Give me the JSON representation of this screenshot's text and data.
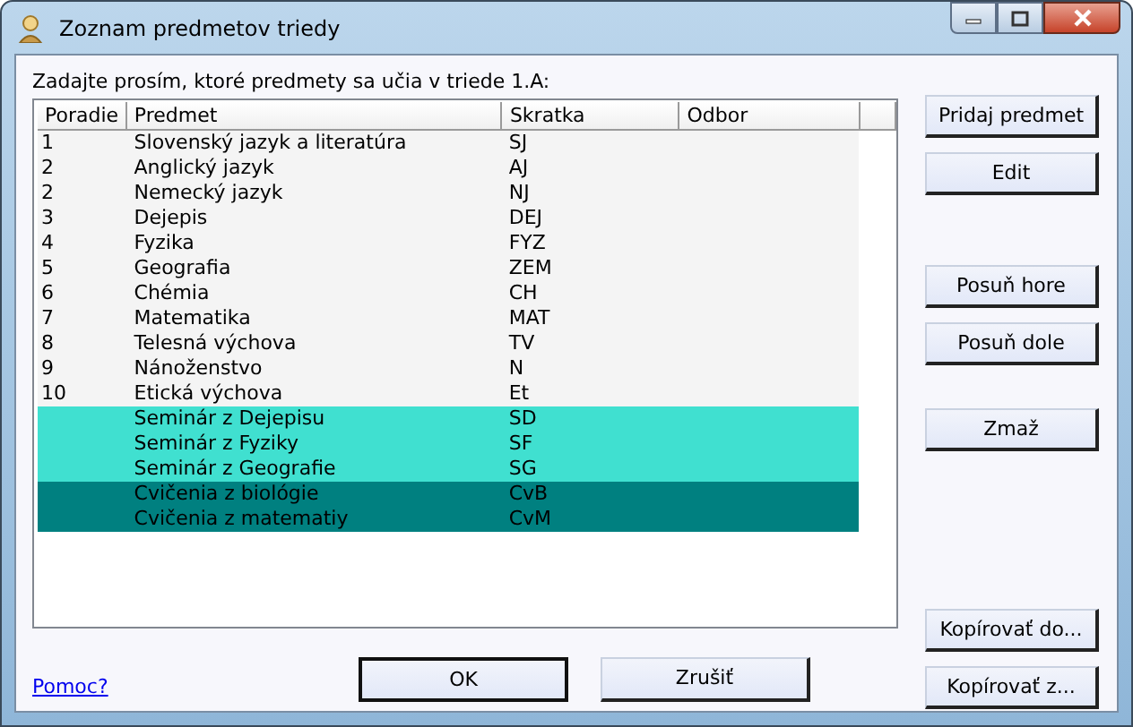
{
  "window": {
    "title": "Zoznam predmetov triedy"
  },
  "prompt": "Zadajte prosím, ktoré predmety sa učia v triede 1.A:",
  "table": {
    "columns": [
      "Poradie",
      "Predmet",
      "Skratka",
      "Odbor"
    ],
    "rows": [
      {
        "poradie": "1",
        "predmet": "Slovenský jazyk a literatúra",
        "skratka": "SJ",
        "color": "#f4f4f4"
      },
      {
        "poradie": "2",
        "predmet": "Anglický jazyk",
        "skratka": "AJ",
        "color": "#f4f4f4"
      },
      {
        "poradie": "2",
        "predmet": "Nemecký jazyk",
        "skratka": "NJ",
        "color": "#f4f4f4"
      },
      {
        "poradie": "3",
        "predmet": "Dejepis",
        "skratka": "DEJ",
        "color": "#f4f4f4"
      },
      {
        "poradie": "4",
        "predmet": "Fyzika",
        "skratka": "FYZ",
        "color": "#f4f4f4"
      },
      {
        "poradie": "5",
        "predmet": "Geografia",
        "skratka": "ZEM",
        "color": "#f4f4f4"
      },
      {
        "poradie": "6",
        "predmet": "Chémia",
        "skratka": "CH",
        "color": "#f4f4f4"
      },
      {
        "poradie": "7",
        "predmet": "Matematika",
        "skratka": "MAT",
        "color": "#f4f4f4"
      },
      {
        "poradie": "8",
        "predmet": "Telesná výchova",
        "skratka": "TV",
        "color": "#f4f4f4"
      },
      {
        "poradie": "9",
        "predmet": "Nánoženstvo",
        "skratka": "N",
        "color": "#f4f4f4"
      },
      {
        "poradie": "10",
        "predmet": "Etická výchova",
        "skratka": "Et",
        "color": "#f4f4f4"
      },
      {
        "poradie": "",
        "predmet": "Seminár z Dejepisu",
        "skratka": "SD",
        "color": "#40e0d0"
      },
      {
        "poradie": "",
        "predmet": "Seminár z Fyziky",
        "skratka": "SF",
        "color": "#40e0d0"
      },
      {
        "poradie": "",
        "predmet": "Seminár z Geografie",
        "skratka": "SG",
        "color": "#40e0d0"
      },
      {
        "poradie": "",
        "predmet": "Cvičenia z biológie",
        "skratka": "CvB",
        "color": "#008080"
      },
      {
        "poradie": "",
        "predmet": "Cvičenia z matematiy",
        "skratka": "CvM",
        "color": "#008080"
      }
    ]
  },
  "side_buttons": [
    "Pridaj predmet",
    "Edit",
    "Posuň hore",
    "Posuň dole",
    "Zmaž"
  ],
  "copy_buttons": [
    "Kopírovať do...",
    "Kopírovať z..."
  ],
  "help_link": "Pomoc?",
  "dialog_buttons": [
    {
      "label": "OK",
      "default": true
    },
    {
      "label": "Zrušiť",
      "default": false
    }
  ]
}
